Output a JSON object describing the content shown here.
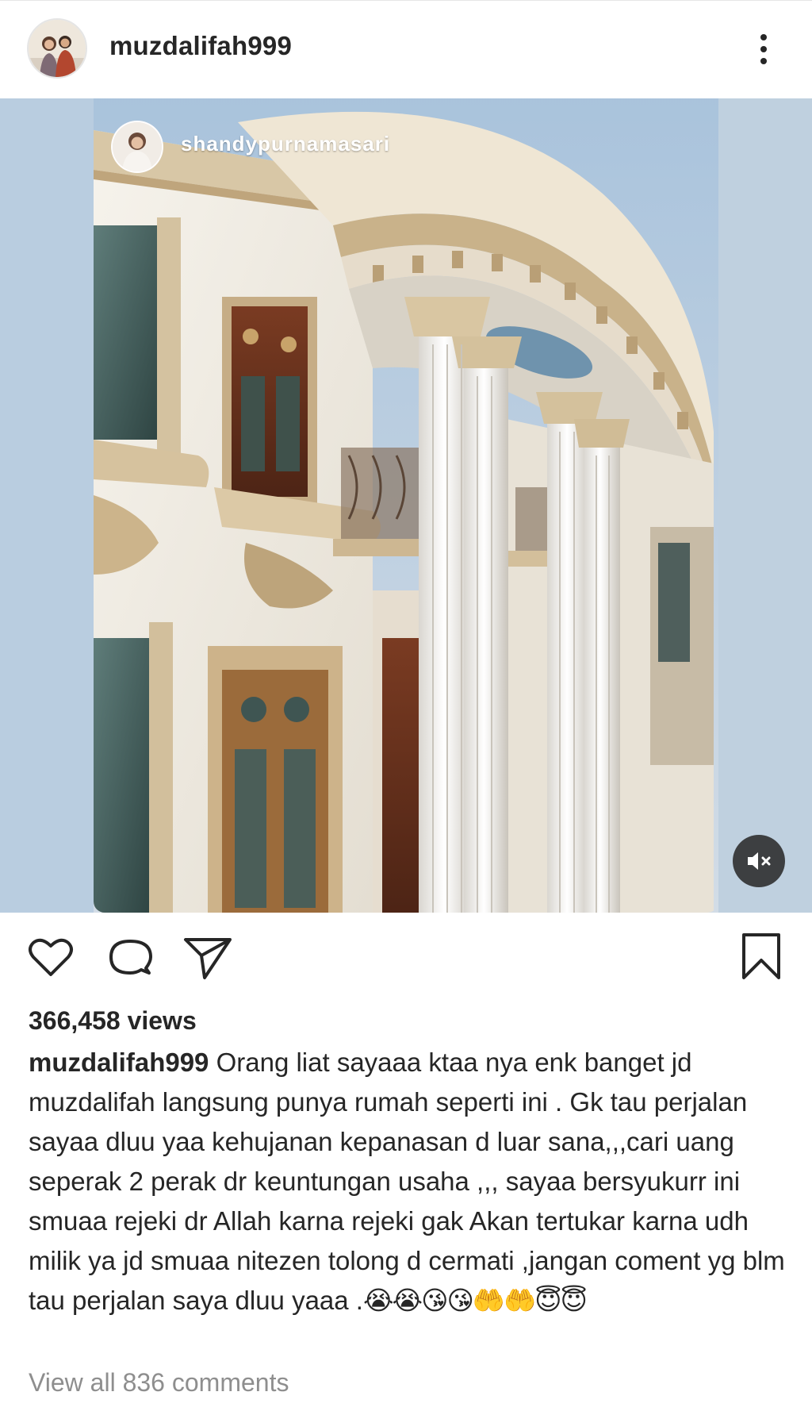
{
  "post": {
    "username": "muzdalifah999",
    "avatar_icon": "profile-photo"
  },
  "media": {
    "type": "video",
    "repost_username": "shandypurnamasari",
    "sound_state": "muted",
    "sky_color": "#b8cde2",
    "wall_color": "#f4f1ea",
    "trim_color": "#cdb895"
  },
  "actions": {
    "like_icon": "heart-icon",
    "comment_icon": "comment-icon",
    "share_icon": "send-icon",
    "save_icon": "bookmark-icon"
  },
  "stats": {
    "views": "366,458 views"
  },
  "caption": {
    "username": "muzdalifah999",
    "text": "Orang liat sayaaa ktaa nya enk banget jd muzdalifah langsung punya rumah seperti ini . Gk tau perjalan sayaa dluu yaa kehujanan kepanasan d luar sana,,,cari uang seperak 2 perak dr keuntungan usaha ,,, sayaa bersyukurr ini smuaa rejeki dr Allah karna rejeki gak Akan tertukar karna udh milik ya jd smuaa nitezen tolong d cermati ,jangan coment yg blm tau perjalan saya dluu yaaa .",
    "emojis": "😭😭😘😘🤲🤲😇😇"
  },
  "comments": {
    "link_label": "View all 836 comments"
  }
}
